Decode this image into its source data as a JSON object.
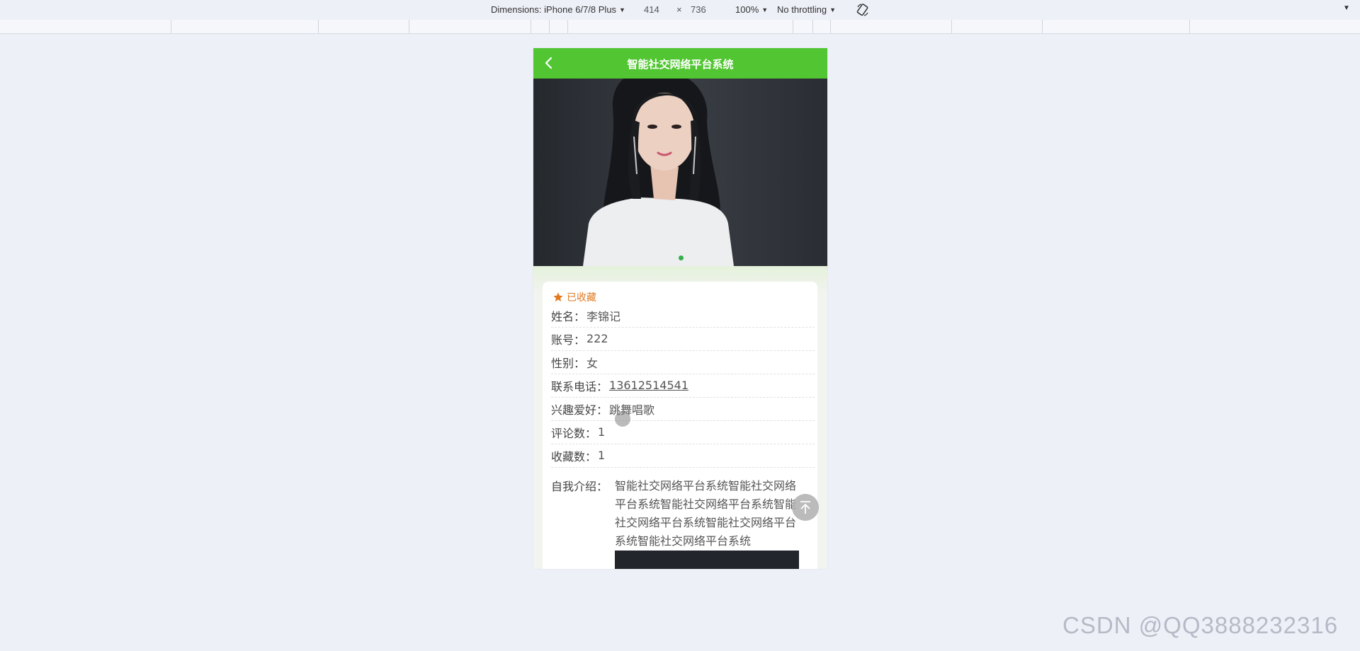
{
  "devtools": {
    "dimensions_label": "Dimensions: iPhone 6/7/8 Plus",
    "width": "414",
    "times": "×",
    "height": "736",
    "zoom": "100%",
    "throttling": "No throttling"
  },
  "app": {
    "title": "智能社交网络平台系统",
    "favorite_label": "已收藏",
    "accent_color": "#52c632",
    "favorite_color": "#e07a20"
  },
  "profile": {
    "fields": [
      {
        "label": "姓名：",
        "value": "李锦记"
      },
      {
        "label": "账号：",
        "value": "222"
      },
      {
        "label": "性别：",
        "value": "女"
      },
      {
        "label": "联系电话：",
        "value": "13612514541"
      },
      {
        "label": "兴趣爱好：",
        "value": "跳舞唱歌"
      },
      {
        "label": "评论数：",
        "value": "1"
      },
      {
        "label": "收藏数：",
        "value": "1"
      }
    ],
    "intro_label": "自我介绍：",
    "intro_value": "智能社交网络平台系统智能社交网络平台系统智能社交网络平台系统智能社交网络平台系统智能社交网络平台系统智能社交网络平台系统"
  },
  "watermark": "CSDN @QQ3888232316"
}
